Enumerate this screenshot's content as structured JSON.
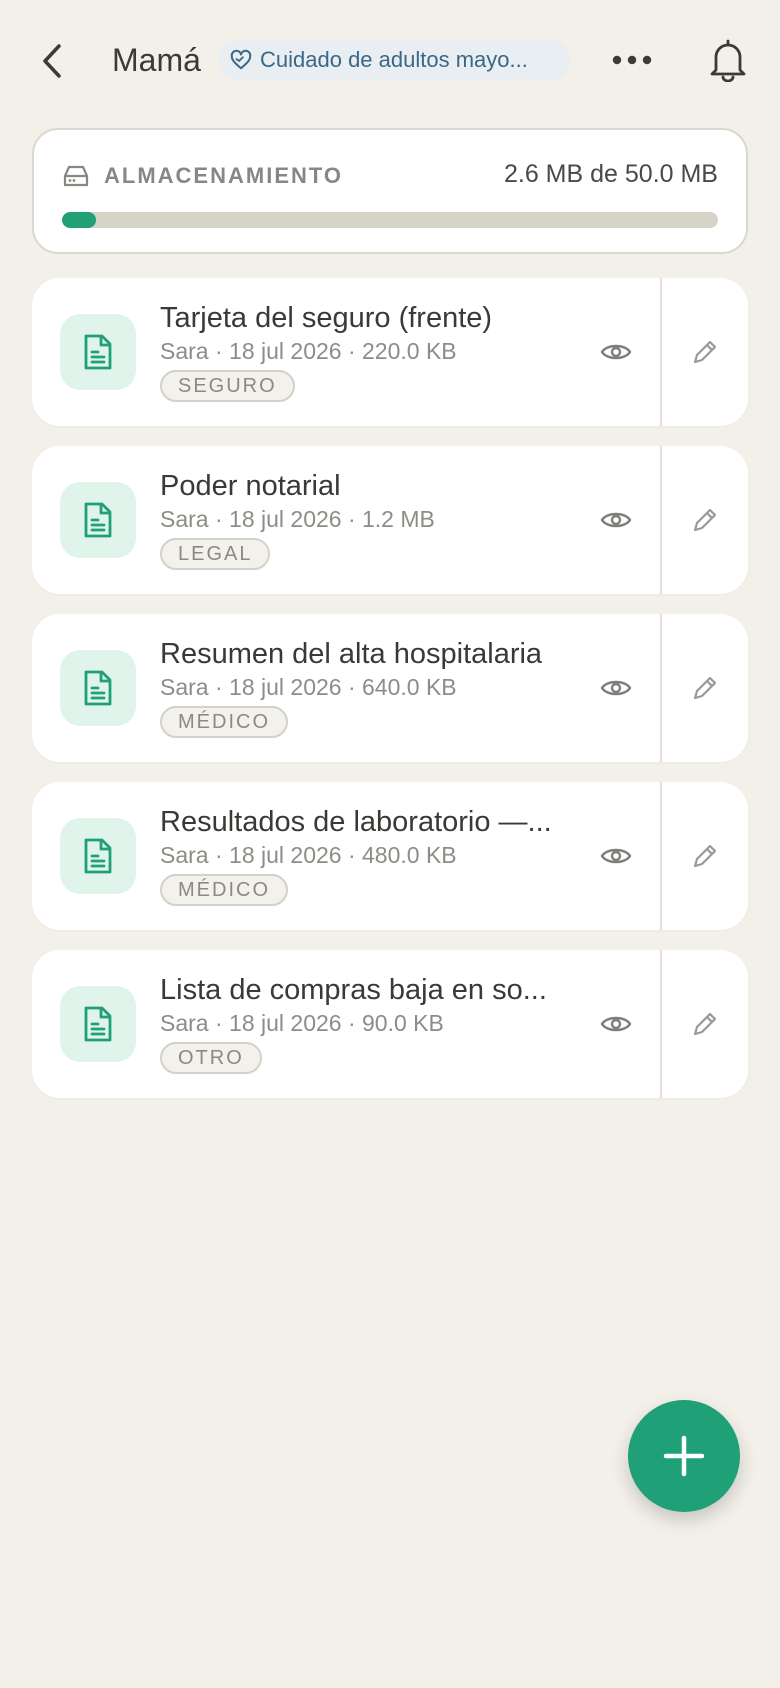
{
  "header": {
    "title": "Mamá",
    "group_chip": "Cuidado de adultos mayo...",
    "icons": {
      "back": "chevron-left-icon",
      "more": "ellipsis-icon",
      "bell": "bell-icon",
      "chip": "heart-hand-icon"
    }
  },
  "storage": {
    "label": "ALMACENAMIENTO",
    "value_text": "2.6 MB de 50.0 MB",
    "used_fraction": 0.052,
    "icon": "hard-drive-icon"
  },
  "documents": [
    {
      "title": "Tarjeta del seguro (frente)",
      "meta": "Sara · 18 jul 2026 · 220.0 KB",
      "tag": "SEGURO"
    },
    {
      "title": "Poder notarial",
      "meta": "Sara · 18 jul 2026 · 1.2 MB",
      "tag": "LEGAL"
    },
    {
      "title": "Resumen del alta hospitalaria",
      "meta": "Sara · 18 jul 2026 · 640.0 KB",
      "tag": "MÉDICO"
    },
    {
      "title": "Resultados de laboratorio —...",
      "meta": "Sara · 18 jul 2026 · 480.0 KB",
      "tag": "MÉDICO"
    },
    {
      "title": "Lista de compras baja en so...",
      "meta": "Sara · 18 jul 2026 · 90.0 KB",
      "tag": "OTRO"
    }
  ],
  "colors": {
    "accent": "#1fa077",
    "background": "#f2f0e9",
    "chip_text": "#3b6889"
  },
  "fab_icon": "plus-icon"
}
